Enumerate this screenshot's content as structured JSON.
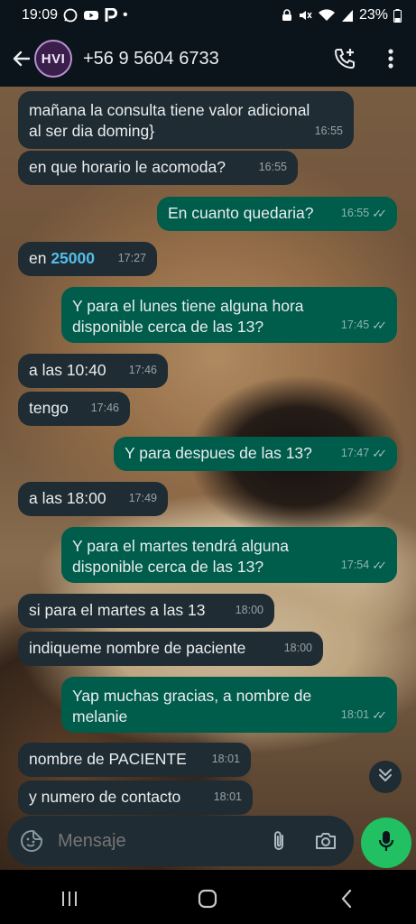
{
  "status_bar": {
    "time": "19:09",
    "dot": "•",
    "battery": "23%",
    "icons": [
      "whatsapp-icon",
      "youtube-icon",
      "p-app-icon",
      "lock-icon",
      "mute-icon",
      "wifi-icon",
      "signal-icon",
      "battery-icon"
    ]
  },
  "header": {
    "avatar_text": "HVI",
    "contact": "+56 9 5604 6733",
    "icons": [
      "back-arrow-icon",
      "add-call-icon",
      "more-vert-icon"
    ]
  },
  "messages": [
    {
      "dir": "in",
      "lines": [
        "mañana la consulta tiene valor adicional",
        "al ser dia doming}"
      ],
      "time": "16:55"
    },
    {
      "dir": "in",
      "lines": [
        "en que horario le acomoda?"
      ],
      "time": "16:55"
    },
    {
      "dir": "out",
      "lines": [
        "En cuanto quedaria?"
      ],
      "time": "16:55"
    },
    {
      "dir": "in",
      "prefix": "en ",
      "highlight": "25000",
      "time": "17:27"
    },
    {
      "dir": "out",
      "lines": [
        "Y para el lunes tiene alguna hora",
        "disponible cerca de las 13?"
      ],
      "time": "17:45"
    },
    {
      "dir": "in",
      "lines": [
        "a las 10:40"
      ],
      "time": "17:46"
    },
    {
      "dir": "in",
      "lines": [
        "tengo"
      ],
      "time": "17:46"
    },
    {
      "dir": "out",
      "lines": [
        "Y para despues de las 13?"
      ],
      "time": "17:47"
    },
    {
      "dir": "in",
      "lines": [
        "a las 18:00"
      ],
      "time": "17:49"
    },
    {
      "dir": "out",
      "lines": [
        "Y para el martes tendrá alguna",
        "disponible cerca de las 13?"
      ],
      "time": "17:54"
    },
    {
      "dir": "in",
      "lines": [
        "si para el martes a las 13"
      ],
      "time": "18:00"
    },
    {
      "dir": "in",
      "lines": [
        "indiqueme nombre de paciente"
      ],
      "time": "18:00"
    },
    {
      "dir": "out",
      "lines": [
        "Yap muchas gracias, a nombre de",
        "melanie"
      ],
      "time": "18:01"
    },
    {
      "dir": "in",
      "lines": [
        "nombre de PACIENTE"
      ],
      "time": "18:01"
    },
    {
      "dir": "in",
      "lines": [
        "y numero de contacto"
      ],
      "time": "18:01"
    }
  ],
  "composer": {
    "placeholder": "Mensaje",
    "icons": [
      "sticker-icon",
      "attach-icon",
      "camera-icon",
      "mic-icon"
    ]
  },
  "scroll_down_icon": "double-chevron-down-icon",
  "nav": {
    "icons": [
      "recents-icon",
      "home-icon",
      "back-icon"
    ]
  },
  "colors": {
    "incoming": "#1f2c33",
    "outgoing": "#005c4b",
    "accent": "#21c063",
    "link_number": "#53bdeb"
  }
}
